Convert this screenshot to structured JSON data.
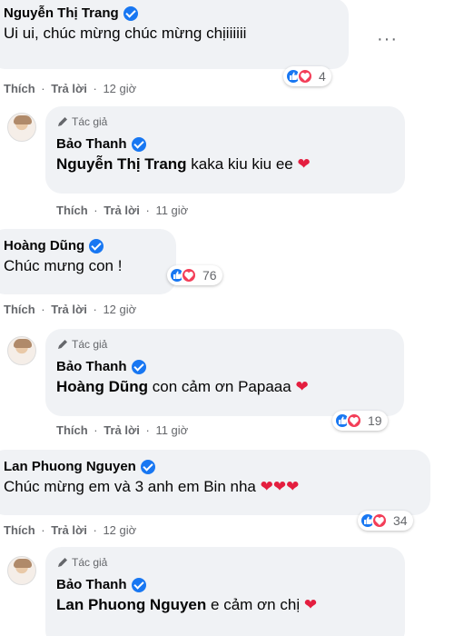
{
  "actions": {
    "like": "Thích",
    "reply": "Trả lời",
    "sep": "·"
  },
  "author_badge": "Tác giả",
  "icons": {
    "verified": "verified-badge-icon",
    "pen": "pen-icon",
    "like": "like-reaction-icon",
    "love": "love-reaction-icon",
    "more": "more-options-icon"
  },
  "colors": {
    "verified": "#1877f2",
    "love": "#f33e58",
    "bubble": "#f0f2f5",
    "muted": "#65676b"
  },
  "more_options": "···",
  "comments": [
    {
      "name": "Nguyễn Thị Trang",
      "text": "Ui ui, chúc mừng chúc mừng chịiiiiii",
      "time": "12 giờ",
      "reactions": "4"
    },
    {
      "name": "Bảo Thanh",
      "mention": "Nguyễn Thị Trang",
      "text": "kaka kiu kiu ee",
      "heart": "❤",
      "time": "11 giờ"
    },
    {
      "name": "Hoàng Dũng",
      "text": "Chúc mưng con !",
      "time": "12 giờ",
      "reactions": "76"
    },
    {
      "name": "Bảo Thanh",
      "mention": "Hoàng Dũng",
      "text": "con cảm ơn Papaaa",
      "heart": "❤",
      "time": "11 giờ",
      "reactions": "19"
    },
    {
      "name": "Lan Phuong Nguyen",
      "text": "Chúc mừng em và 3 anh em Bin nha",
      "hearts": "❤❤❤",
      "time": "12 giờ",
      "reactions": "34"
    },
    {
      "name": "Bảo Thanh",
      "mention": "Lan Phuong Nguyen",
      "text": "e cảm ơn chị",
      "heart": "❤"
    }
  ]
}
